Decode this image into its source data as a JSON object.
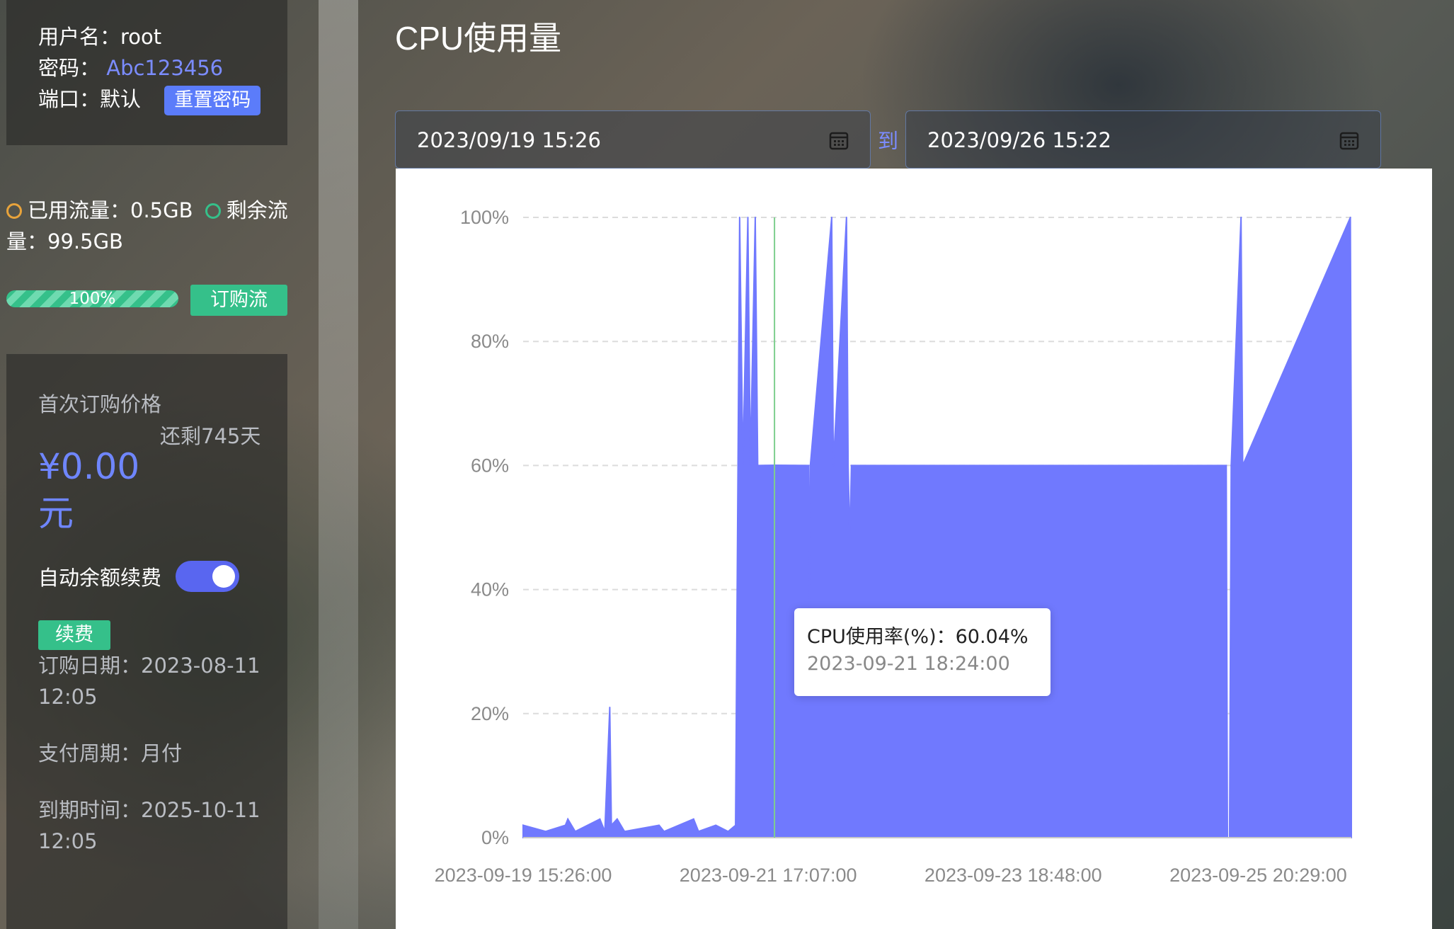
{
  "account": {
    "username_label": "用户名：",
    "username": "root",
    "password_label": "密码：",
    "password": "Abc123456",
    "port_label": "端口：",
    "port": "默认",
    "reset_password_button": "重置密码"
  },
  "traffic": {
    "used_label": "已用流量：",
    "used": "0.5GB",
    "remaining_label_part1": "剩余流",
    "remaining_label_part2": "量：",
    "remaining": "99.5GB",
    "progress_text": "100%",
    "progress_value": 100,
    "buy_traffic_button": "订购流"
  },
  "subscription": {
    "first_price_label": "首次订购价格",
    "days_left": "还剩745天",
    "price_line1": "¥0.00",
    "price_line2": "元",
    "auto_renew_label": "自动余额续费",
    "auto_renew_on": true,
    "renew_button": "续费",
    "order_date_label": "订购日期：2023-08-11",
    "order_date_time": "12:05",
    "pay_cycle": "支付周期：月付",
    "expire_label": "到期时间：2025-10-11",
    "expire_time": "12:05"
  },
  "main": {
    "title": "CPU使用量",
    "date_from": "2023/09/19  15:26",
    "date_separator": "到",
    "date_to": "2023/09/26  15:22",
    "tooltip_line1": "CPU使用率(%)：60.04%",
    "tooltip_line2": "2023-09-21 18:24:00"
  },
  "colors": {
    "series": "#7079fe",
    "accent_blue": "#5b7cfa",
    "accent_green": "#35c08a",
    "marker_line": "#7ecf8e"
  },
  "chart_data": {
    "type": "area",
    "title": "",
    "xlabel": "",
    "ylabel": "",
    "ylim": [
      0,
      100
    ],
    "y_ticks": [
      "0%",
      "20%",
      "40%",
      "60%",
      "80%",
      "100%"
    ],
    "x_tick_labels": [
      "2023-09-19 15:26:00",
      "2023-09-21 17:07:00",
      "2023-09-23 18:48:00",
      "2023-09-25 20:29:00"
    ],
    "x_range": [
      "2023-09-19 15:26:00",
      "2023-09-26 15:22:00"
    ],
    "grid": true,
    "series": [
      {
        "name": "CPU使用率(%)",
        "points": [
          [
            "2023-09-19 15:26",
            2
          ],
          [
            "2023-09-19 20:00",
            1
          ],
          [
            "2023-09-20 00:00",
            2
          ],
          [
            "2023-09-20 00:30",
            3
          ],
          [
            "2023-09-20 02:00",
            1
          ],
          [
            "2023-09-20 07:00",
            3
          ],
          [
            "2023-09-20 08:00",
            1
          ],
          [
            "2023-09-20 09:00",
            21
          ],
          [
            "2023-09-20 09:20",
            2
          ],
          [
            "2023-09-20 10:30",
            3
          ],
          [
            "2023-09-20 12:00",
            1
          ],
          [
            "2023-09-20 19:00",
            2
          ],
          [
            "2023-09-20 20:00",
            1
          ],
          [
            "2023-09-21 02:00",
            3
          ],
          [
            "2023-09-21 03:00",
            1
          ],
          [
            "2023-09-21 06:30",
            2
          ],
          [
            "2023-09-21 09:00",
            1
          ],
          [
            "2023-09-21 10:30",
            2
          ],
          [
            "2023-09-21 11:00",
            60
          ],
          [
            "2023-09-21 11:20",
            100
          ],
          [
            "2023-09-21 11:40",
            80
          ],
          [
            "2023-09-21 12:00",
            60
          ],
          [
            "2023-09-21 13:00",
            100
          ],
          [
            "2023-09-21 13:30",
            60
          ],
          [
            "2023-09-21 14:30",
            100
          ],
          [
            "2023-09-21 15:00",
            60
          ],
          [
            "2023-09-21 18:24",
            60.04
          ],
          [
            "2023-09-22 01:20",
            60
          ],
          [
            "2023-09-22 01:30",
            35
          ],
          [
            "2023-09-22 01:40",
            60
          ],
          [
            "2023-09-22 06:00",
            100
          ],
          [
            "2023-09-22 06:20",
            60
          ],
          [
            "2023-09-22 09:00",
            100
          ],
          [
            "2023-09-22 09:20",
            60
          ],
          [
            "2023-09-22 09:40",
            48
          ],
          [
            "2023-09-22 10:00",
            60
          ],
          [
            "2023-09-25 14:00",
            60
          ],
          [
            "2023-09-25 14:15",
            0
          ],
          [
            "2023-09-25 14:40",
            0
          ],
          [
            "2023-09-25 15:00",
            60
          ],
          [
            "2023-09-25 17:00",
            100
          ],
          [
            "2023-09-25 17:20",
            60
          ],
          [
            "2023-09-26 15:10",
            100
          ],
          [
            "2023-09-26 15:22",
            60
          ]
        ]
      }
    ],
    "tooltip_point": {
      "x": "2023-09-21 18:24:00",
      "y": 60.04
    }
  }
}
